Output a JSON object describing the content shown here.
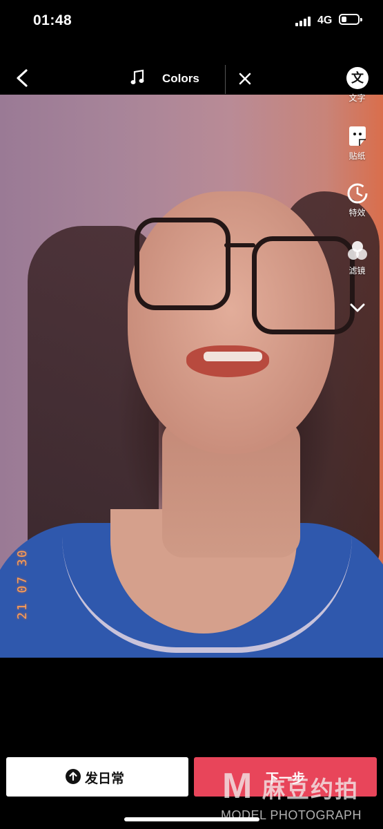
{
  "status_bar": {
    "time": "01:48",
    "network": "4G",
    "battery_level": 0.3
  },
  "topbar": {
    "music_label": "Colors",
    "back_icon": "chevron-left-icon",
    "music_icon": "music-note-icon",
    "close_icon": "close-icon"
  },
  "photo": {
    "date_stamp": "21 07 30"
  },
  "tools": [
    {
      "label": "文字",
      "icon": "text-icon"
    },
    {
      "label": "贴纸",
      "icon": "sticker-icon"
    },
    {
      "label": "特效",
      "icon": "effects-icon"
    },
    {
      "label": "滤镜",
      "icon": "filter-icon"
    }
  ],
  "bottom": {
    "daily_label": "发日常",
    "next_label": "下一步"
  },
  "watermark": {
    "logo_letter": "M",
    "logo_cn": "麻豆约拍",
    "text": "MODEL PHOTOGRAPH"
  },
  "colors": {
    "accent": "#e8455a",
    "background": "#000000"
  }
}
